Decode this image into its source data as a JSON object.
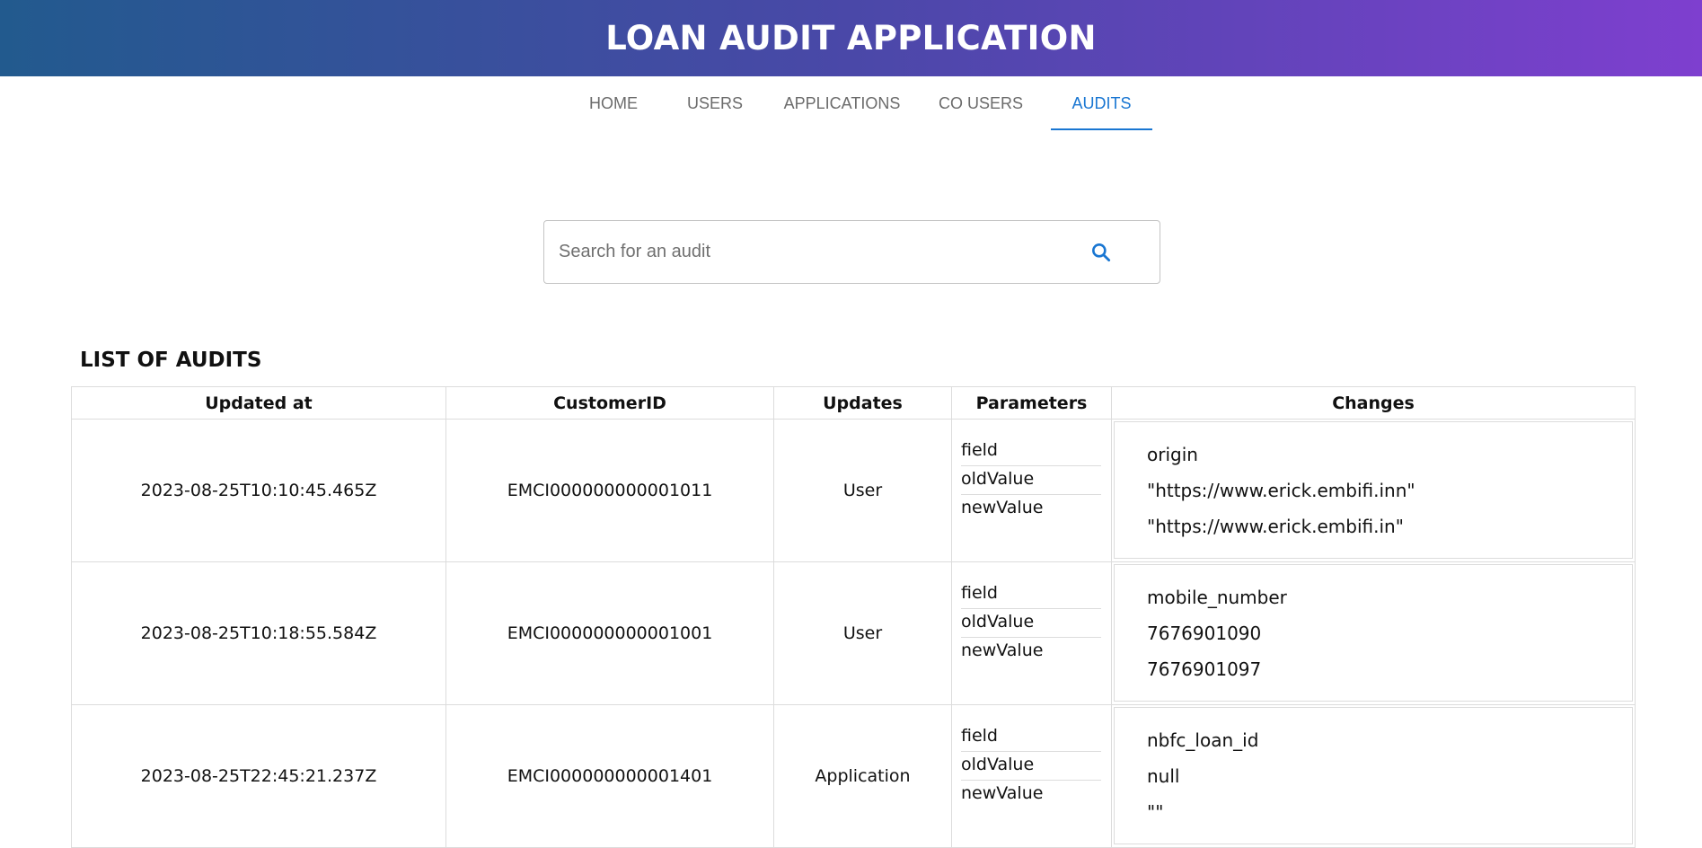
{
  "header": {
    "title": "LOAN AUDIT APPLICATION"
  },
  "nav": {
    "tabs": [
      {
        "label": "HOME"
      },
      {
        "label": "USERS"
      },
      {
        "label": "APPLICATIONS"
      },
      {
        "label": "CO USERS"
      },
      {
        "label": "AUDITS"
      }
    ],
    "active": "AUDITS"
  },
  "search": {
    "placeholder": "Search for an audit",
    "value": "",
    "icon": "search-icon"
  },
  "list": {
    "title": "LIST OF AUDITS",
    "columns": [
      "Updated at",
      "CustomerID",
      "Updates",
      "Parameters",
      "Changes"
    ],
    "rows": [
      {
        "updated_at": "2023-08-25T10:10:45.465Z",
        "customer_id": "EMCI000000000001011",
        "updates": "User",
        "parameters": [
          "field",
          "oldValue",
          "newValue"
        ],
        "changes": [
          "origin",
          "\"https://www.erick.embifi.inn\"",
          "\"https://www.erick.embifi.in\""
        ]
      },
      {
        "updated_at": "2023-08-25T10:18:55.584Z",
        "customer_id": "EMCI000000000001001",
        "updates": "User",
        "parameters": [
          "field",
          "oldValue",
          "newValue"
        ],
        "changes": [
          "mobile_number",
          "7676901090",
          "7676901097"
        ]
      },
      {
        "updated_at": "2023-08-25T22:45:21.237Z",
        "customer_id": "EMCI000000000001401",
        "updates": "Application",
        "parameters": [
          "field",
          "oldValue",
          "newValue"
        ],
        "changes": [
          "nbfc_loan_id",
          "null",
          "\"\""
        ]
      }
    ]
  },
  "colors": {
    "accent": "#1976d2",
    "header_start": "#225a8e",
    "header_end": "#7e3fcf"
  }
}
